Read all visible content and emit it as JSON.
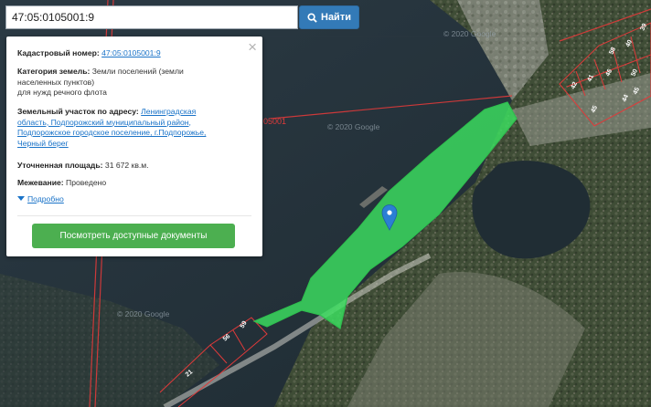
{
  "search": {
    "value": "47:05:0105001:9",
    "button_label": "Найти"
  },
  "popup": {
    "close_glyph": "×",
    "cadastral_label": "Кадастровый номер:",
    "cadastral_number": "47:05:0105001:9",
    "category_label": "Категория земель:",
    "category_value_line1": "Земли поселений (земли",
    "category_value_line2": "населенных пунктов)",
    "category_value_line3": "для нужд речного флота",
    "address_label": "Земельный участок по адресу:",
    "address_line1": "Ленинградская",
    "address_line2": "область, Подпорожский муниципальный район,",
    "address_line3": "Подпорожское городское поселение, г.Подпорожье,",
    "address_line4": "Черный берег",
    "area_label": "Уточненная площадь:",
    "area_value": "31 672 кв.м.",
    "survey_label": "Межевание:",
    "survey_value": "Проведено",
    "more_link": "Подробно",
    "docs_button": "Посмотреть доступные документы"
  },
  "map": {
    "watermarks": [
      "© 2020 Google",
      "© 2020 Google",
      "© 2020 Google"
    ],
    "quarter_label": "05001",
    "parcel_labels": [
      "21",
      "56",
      "59",
      "42",
      "41",
      "46",
      "58",
      "40",
      "45",
      "44",
      "45",
      "50",
      "39"
    ],
    "highlight_color": "#3ce060",
    "boundary_color": "#e03a3a",
    "marker_color": "#2b7fd4"
  }
}
